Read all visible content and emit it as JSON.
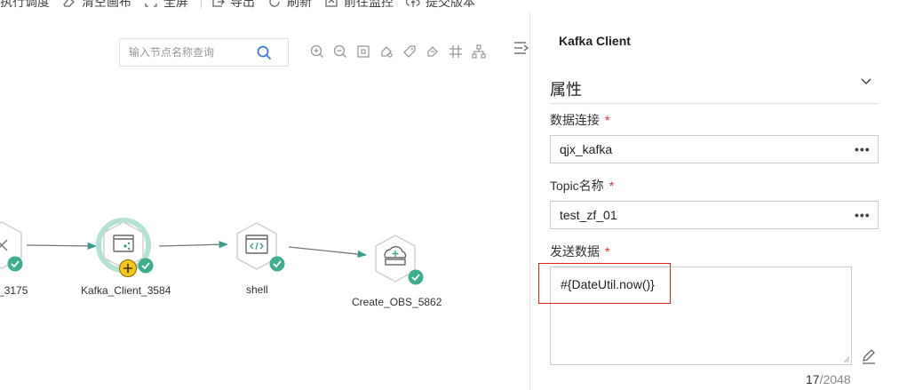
{
  "toolbar": {
    "items": [
      {
        "label": "执行调度",
        "icon": "schedule-icon"
      },
      {
        "label": "清空画布",
        "icon": "eraser-icon"
      },
      {
        "label": "全屏",
        "icon": "fullscreen-icon"
      },
      {
        "label": "导出",
        "icon": "export-icon"
      },
      {
        "label": "刷新",
        "icon": "refresh-icon"
      },
      {
        "label": "前往监控",
        "icon": "monitor-icon"
      },
      {
        "label": "提交版本",
        "icon": "upload-icon"
      }
    ]
  },
  "canvas": {
    "search_placeholder": "输入节点名称查询",
    "tools": [
      "zoom-in-icon",
      "zoom-out-icon",
      "fit-icon",
      "format-icon",
      "tag-icon",
      "format-brush-icon",
      "grid-icon",
      "layout-icon"
    ],
    "nodes": [
      {
        "label": "_3175",
        "icon": "tool-node-icon",
        "status": "success"
      },
      {
        "label": "Kafka_Client_3584",
        "icon": "kafka-node-icon",
        "status": "success",
        "selected": true
      },
      {
        "label": "shell",
        "icon": "shell-node-icon",
        "status": "success"
      },
      {
        "label": "Create_OBS_5862",
        "icon": "obs-node-icon",
        "status": "success"
      }
    ]
  },
  "panel": {
    "title": "Kafka Client",
    "section": "属性",
    "fields": {
      "connection": {
        "label": "数据连接",
        "required_mark": "*",
        "value": "qjx_kafka",
        "action": "•••"
      },
      "topic": {
        "label": "Topic名称",
        "required_mark": "*",
        "value": "test_zf_01",
        "action": "•••"
      },
      "send_data": {
        "label": "发送数据",
        "required_mark": "*",
        "value": "#{DateUtil.now()}",
        "count": "17",
        "max": "/2048"
      }
    }
  },
  "colors": {
    "accent": "#3c9b8c",
    "success": "#3fae8c",
    "highlight": "#d9281e",
    "warn": "#f5c518"
  }
}
